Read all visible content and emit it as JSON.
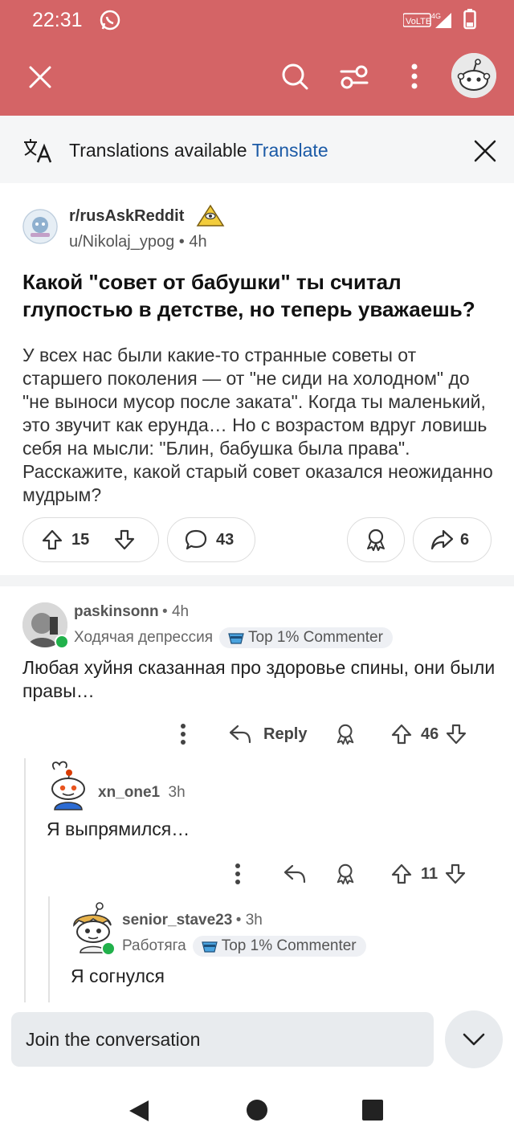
{
  "status_bar": {
    "time": "22:31",
    "network": "VoLTE 4G"
  },
  "header": {
    "icons": [
      "close-icon",
      "search-icon",
      "filter-icon",
      "more-vert-icon",
      "avatar"
    ]
  },
  "translation_banner": {
    "text": "Translations available",
    "action": "Translate"
  },
  "post": {
    "subreddit": "r/rusAskReddit",
    "author": "u/Nikolaj_ypog",
    "age": "4h",
    "title": "Какой \"совет от бабушки\" ты считал глупостью в детстве, но теперь уважаешь?",
    "body": "У всех нас были какие-то странные советы от старшего поколения — от \"не сиди на холодном\" до \"не выноси мусор после заката\". Когда ты маленький, это звучит как ерунда… Но с возрастом вдруг ловишь себя на мысли: \"Блин, бабушка была права\". Расскажите, какой старый совет оказался неожиданно мудрым?",
    "votes": "15",
    "comments": "43",
    "shares": "6"
  },
  "comments": [
    {
      "user": "paskinsonn",
      "age": "4h",
      "flair": "Ходячая депрессия",
      "badge": "Top 1% Commenter",
      "text": "Любая хуйня сказанная про здоровье спины, они были правы…",
      "reply_label": "Reply",
      "votes": "46"
    },
    {
      "user": "xn_one1",
      "age": "3h",
      "text": "Я выпрямился…",
      "votes": "11"
    },
    {
      "user": "senior_stave23",
      "age": "3h",
      "flair": "Работяга",
      "badge": "Top 1% Commenter",
      "text": "Я согнулся"
    }
  ],
  "composer": {
    "placeholder": "Join the conversation"
  },
  "colors": {
    "header": "#d46466",
    "link": "#1b5aa6",
    "online": "#21b14b"
  }
}
